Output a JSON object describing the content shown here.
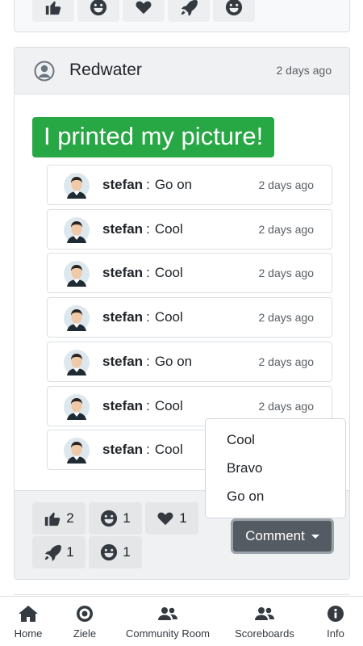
{
  "previous_post": {
    "reaction_icons": [
      "thumbs-up-icon",
      "grin-icon",
      "heart-icon",
      "rocket-icon",
      "grin-tongue-icon"
    ]
  },
  "post": {
    "author": "Redwater",
    "time": "2 days ago",
    "title": "I printed my picture!",
    "comments": [
      {
        "user": "stefan",
        "separator": ":",
        "text": "Go on",
        "time": "2 days ago"
      },
      {
        "user": "stefan",
        "separator": ":",
        "text": "Cool",
        "time": "2 days ago"
      },
      {
        "user": "stefan",
        "separator": ":",
        "text": "Cool",
        "time": "2 days ago"
      },
      {
        "user": "stefan",
        "separator": ":",
        "text": "Cool",
        "time": "2 days ago"
      },
      {
        "user": "stefan",
        "separator": ":",
        "text": "Go on",
        "time": "2 days ago"
      },
      {
        "user": "stefan",
        "separator": ":",
        "text": "Cool",
        "time": "2 days ago"
      },
      {
        "user": "stefan",
        "separator": ":",
        "text": "Cool",
        "time": ""
      }
    ],
    "reactions": [
      {
        "icon": "thumbs-up-icon",
        "count": "2"
      },
      {
        "icon": "grin-icon",
        "count": "1"
      },
      {
        "icon": "heart-icon",
        "count": "1"
      },
      {
        "icon": "rocket-icon",
        "count": "1"
      },
      {
        "icon": "grin-tongue-icon",
        "count": "1"
      }
    ],
    "comment_button_label": "Comment",
    "comment_options": [
      "Cool",
      "Bravo",
      "Go on"
    ]
  },
  "nav": {
    "items": [
      {
        "label": "Home",
        "icon": "home-icon"
      },
      {
        "label": "Ziele",
        "icon": "target-icon"
      },
      {
        "label": "Community Room",
        "icon": "users-icon"
      },
      {
        "label": "Scoreboards",
        "icon": "users-icon"
      },
      {
        "label": "Info",
        "icon": "info-icon"
      }
    ]
  },
  "colors": {
    "title_bg": "#28a745",
    "button_bg": "#555b62",
    "card_header_bg": "#f0f1f3",
    "reaction_bg": "#e4e6e8"
  }
}
